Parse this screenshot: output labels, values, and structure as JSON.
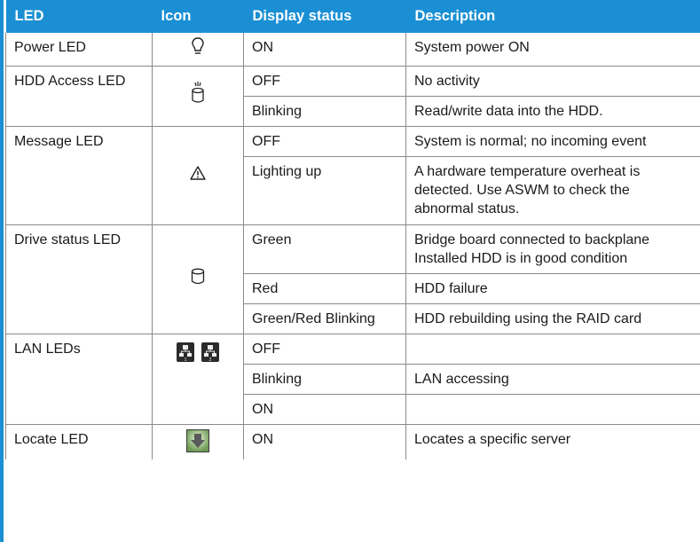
{
  "headers": {
    "led": "LED",
    "icon": "Icon",
    "status": "Display status",
    "description": "Description"
  },
  "rows": {
    "power": {
      "led": "Power LED",
      "icon": "lightbulb-icon",
      "status": "ON",
      "description": "System power ON"
    },
    "hdd": {
      "led": "HDD Access LED",
      "icon": "hdd-access-icon",
      "states": [
        {
          "status": "OFF",
          "description": "No activity"
        },
        {
          "status": "Blinking",
          "description": "Read/write data into the HDD."
        }
      ]
    },
    "message": {
      "led": "Message LED",
      "icon": "warning-triangle-icon",
      "states": [
        {
          "status": "OFF",
          "description": "System is normal; no incoming event"
        },
        {
          "status": "Lighting up",
          "description": "A hardware temperature overheat is detected. Use ASWM to check the abnormal status."
        }
      ]
    },
    "drive": {
      "led": "Drive status LED",
      "icon": "drive-cylinder-icon",
      "states": [
        {
          "status": "Green",
          "description": "Bridge board connected to backplane Installed HDD is in good condition"
        },
        {
          "status": "Red",
          "description": "HDD failure"
        },
        {
          "status": "Green/Red Blinking",
          "description": "HDD rebuilding using the RAID card"
        }
      ]
    },
    "lan": {
      "led": "LAN LEDs",
      "icon": "lan-network-icon",
      "states": [
        {
          "status": "OFF",
          "description": ""
        },
        {
          "status": "Blinking",
          "description": "LAN accessing"
        },
        {
          "status": "ON",
          "description": ""
        }
      ]
    },
    "locate": {
      "led": "Locate LED",
      "icon": "locate-arrow-icon",
      "status": "ON",
      "description": "Locates a specific server"
    }
  },
  "colors": {
    "header_bg": "#1a8fd4",
    "header_text": "#ffffff",
    "border": "#8a8a8a"
  }
}
